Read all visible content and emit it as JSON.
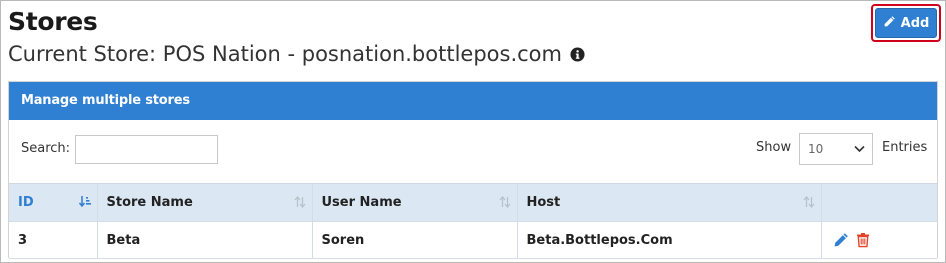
{
  "header": {
    "title": "Stores",
    "current_store": "Current Store: POS Nation - posnation.bottlepos.com",
    "add_label": "Add"
  },
  "panel": {
    "title": "Manage multiple stores",
    "search_label": "Search:",
    "search_value": "",
    "show_label": "Show",
    "page_size": "10",
    "entries_label": "Entries"
  },
  "table": {
    "columns": [
      "ID",
      "Store Name",
      "User Name",
      "Host",
      ""
    ],
    "rows": [
      {
        "id": "3",
        "store_name": "Beta",
        "user_name": "Soren",
        "host": "Beta.Bottlepos.Com"
      }
    ]
  },
  "colors": {
    "accent": "#2f7fd2",
    "highlight": "#d0021b",
    "header_row": "#dbe7f2",
    "delete": "#e0452c"
  }
}
